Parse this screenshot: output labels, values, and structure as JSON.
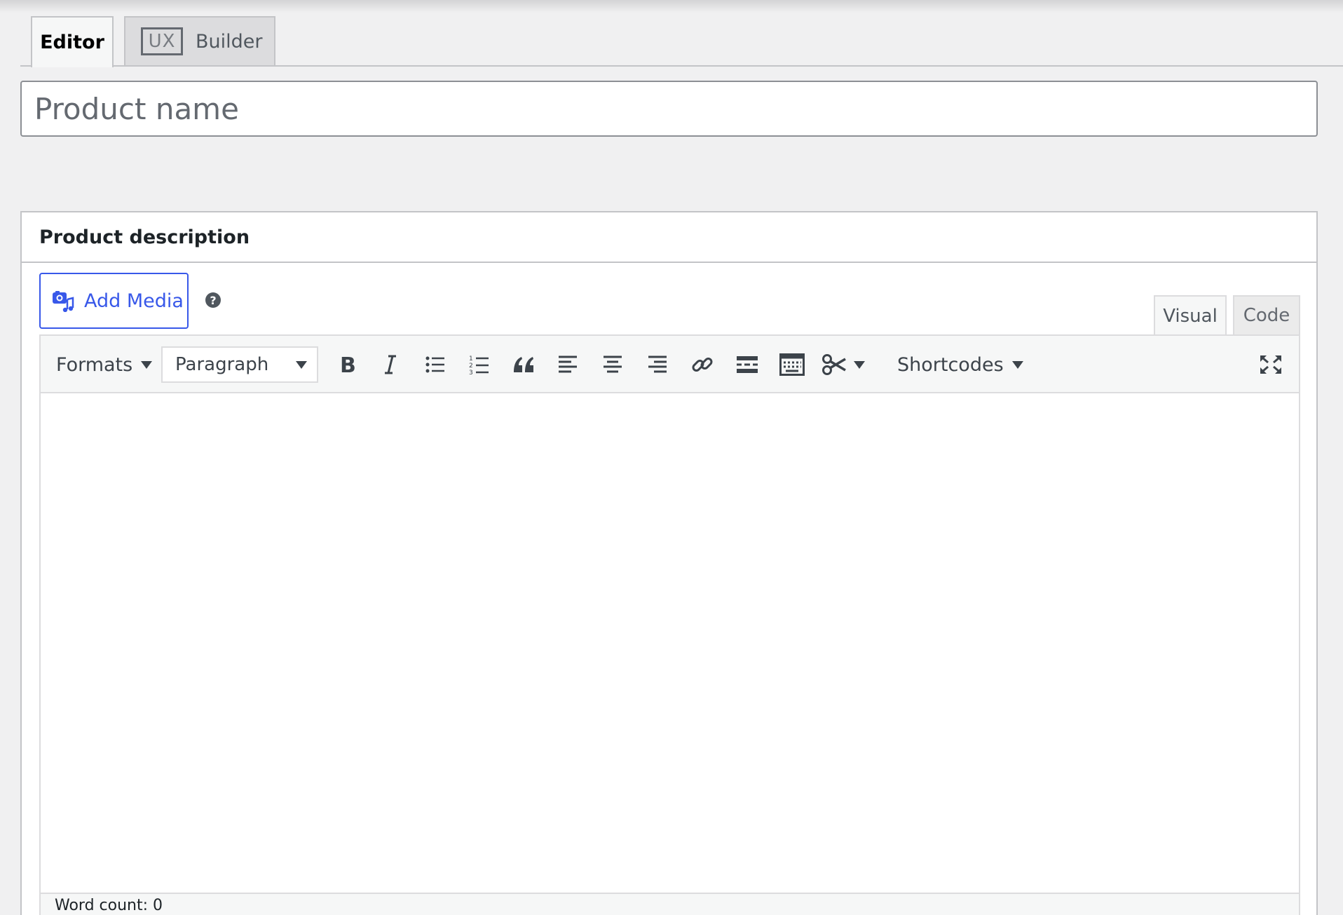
{
  "tabs": {
    "editor_label": "Editor",
    "builder_badge": "UX",
    "builder_label": "Builder"
  },
  "title_field": {
    "placeholder": "Product name",
    "value": ""
  },
  "description": {
    "heading": "Product description",
    "add_media_label": "Add Media",
    "help_symbol": "?",
    "mode_tabs": {
      "visual": "Visual",
      "code": "Code"
    },
    "toolbar": {
      "formats_label": "Formats",
      "block_format_value": "Paragraph",
      "shortcodes_label": "Shortcodes",
      "buttons": [
        "bold-icon",
        "italic-icon",
        "bulleted-list-icon",
        "numbered-list-icon",
        "blockquote-icon",
        "align-left-icon",
        "align-center-icon",
        "align-right-icon",
        "link-icon",
        "read-more-icon",
        "toolbar-toggle-icon",
        "shortcode-scissors-icon",
        "fullscreen-icon"
      ]
    },
    "status": {
      "word_count_label": "Word count: 0"
    }
  },
  "colors": {
    "accent": "#3858e9",
    "background": "#f0f0f1",
    "border": "#c3c4c7",
    "icon": "#3c434a"
  }
}
